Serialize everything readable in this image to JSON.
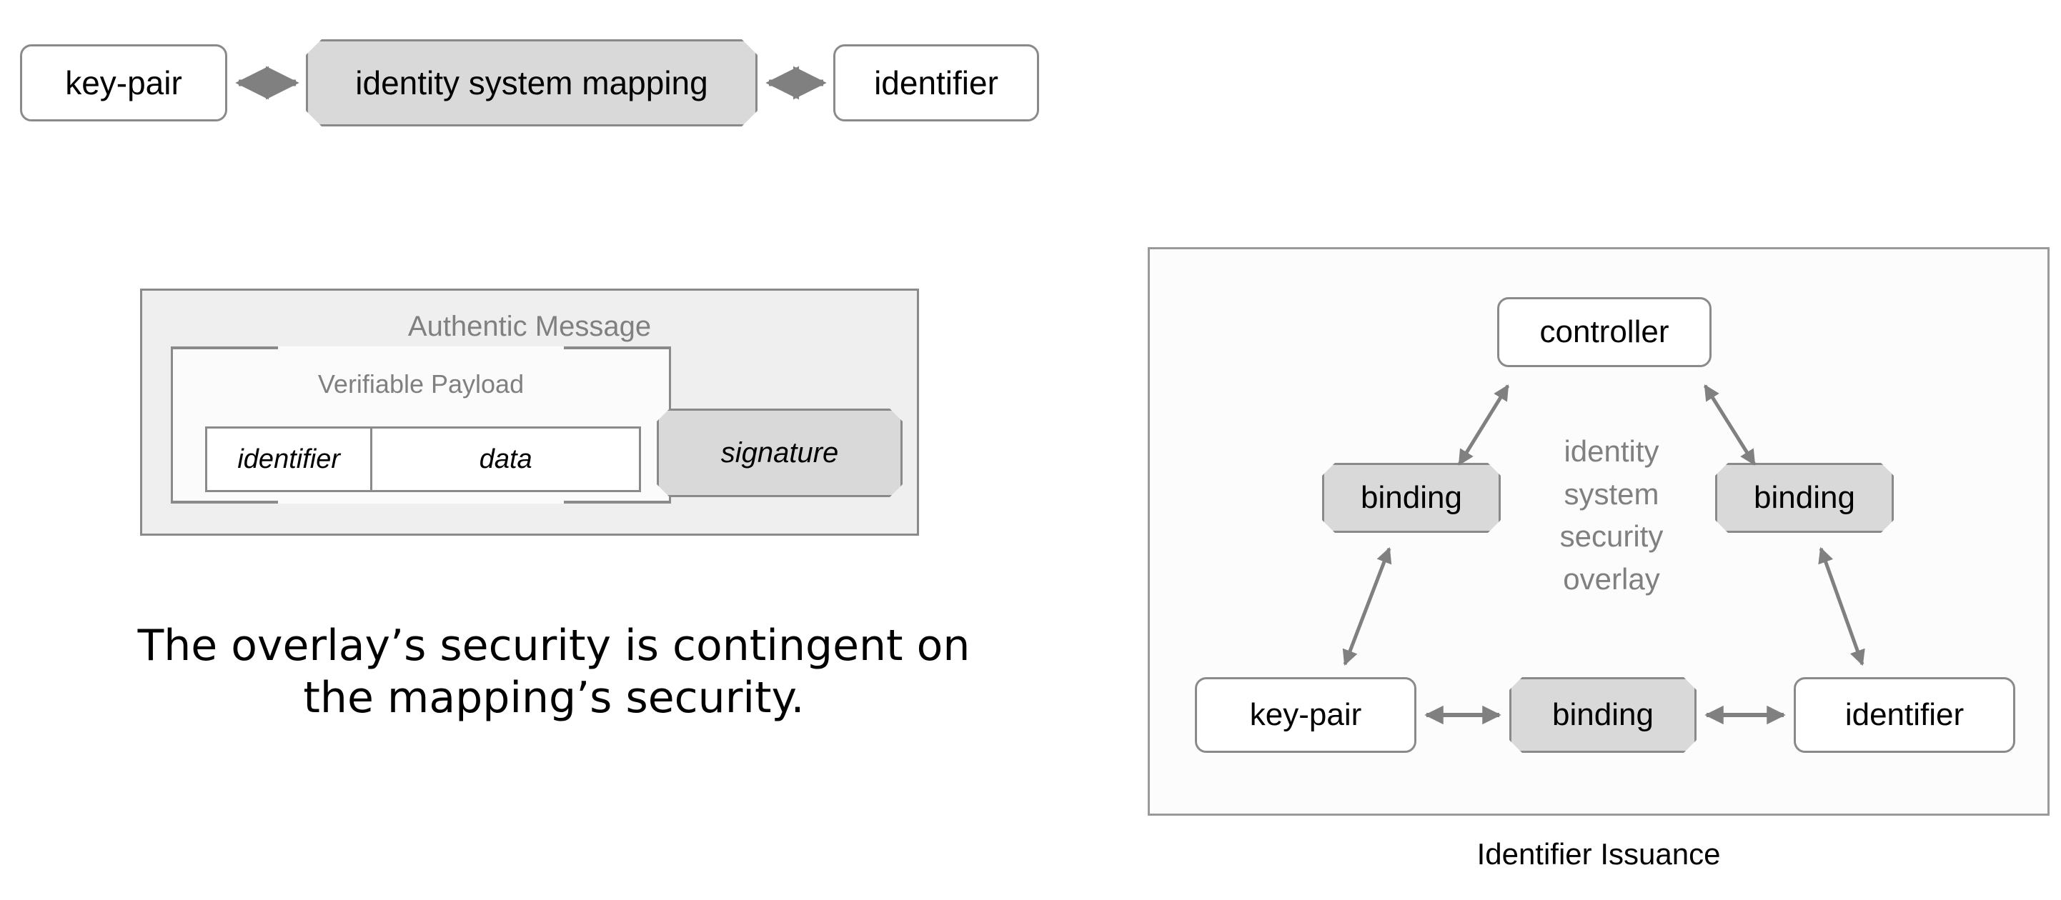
{
  "top_row": {
    "nodes": [
      {
        "id": "key-pair",
        "label": "key-pair",
        "shape": "rounded-rect"
      },
      {
        "id": "identity-system-mapping",
        "label": "identity system mapping",
        "shape": "octagon"
      },
      {
        "id": "identifier",
        "label": "identifier",
        "shape": "rounded-rect"
      }
    ],
    "connectors": [
      {
        "from": "key-pair",
        "to": "identity system mapping",
        "style": "double-arrow"
      },
      {
        "from": "identity system mapping",
        "to": "identifier",
        "style": "double-arrow"
      }
    ]
  },
  "authentic_message": {
    "title": "Authentic Message",
    "verifiable_payload": {
      "title": "Verifiable Payload",
      "fields": [
        {
          "label": "identifier"
        },
        {
          "label": "data"
        }
      ]
    },
    "signature": {
      "label": "signature",
      "shape": "octagon"
    }
  },
  "statement": {
    "text": "The overlay’s security is contingent on the mapping’s security."
  },
  "issuance_diagram": {
    "caption": "Identifier Issuance",
    "center_label": "identity system security overlay",
    "center_label_lines": [
      "identity",
      "system",
      "security",
      "overlay"
    ],
    "nodes": [
      {
        "id": "controller",
        "label": "controller",
        "shape": "rounded-rect"
      },
      {
        "id": "binding-left",
        "label": "binding",
        "shape": "octagon"
      },
      {
        "id": "binding-right",
        "label": "binding",
        "shape": "octagon"
      },
      {
        "id": "key-pair",
        "label": "key-pair",
        "shape": "rounded-rect"
      },
      {
        "id": "binding-bottom",
        "label": "binding",
        "shape": "octagon"
      },
      {
        "id": "identifier",
        "label": "identifier",
        "shape": "rounded-rect"
      }
    ],
    "connectors": [
      {
        "from": "binding-left",
        "to": "controller",
        "style": "double-arrow"
      },
      {
        "from": "binding-right",
        "to": "controller",
        "style": "double-arrow"
      },
      {
        "from": "key-pair",
        "to": "binding-left",
        "style": "double-arrow"
      },
      {
        "from": "identifier",
        "to": "binding-right",
        "style": "double-arrow"
      },
      {
        "from": "key-pair",
        "to": "binding-bottom",
        "style": "double-arrow"
      },
      {
        "from": "binding-bottom",
        "to": "identifier",
        "style": "double-arrow"
      }
    ]
  },
  "colors": {
    "octagon_fill": "#d9d9d9",
    "node_stroke": "#8a8a8a",
    "panel_fill": "#efefef",
    "muted_text": "#808080",
    "arrow": "#808080",
    "body_text": "#000000"
  }
}
